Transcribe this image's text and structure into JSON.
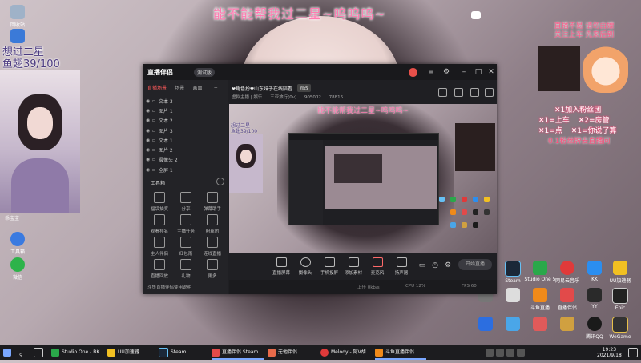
{
  "overlay_title": "能不能帮我过二星~呜呜呜~",
  "camera": {
    "text_line1": "想过二星",
    "text_line2": "鱼翅39/100",
    "name": "乖宝宝"
  },
  "right_panel": {
    "line1": "直播不易 请勿白嫖",
    "line2": "关注上车 先来后到",
    "rules": [
      "✕1加入粉丝团",
      "✕1=上车",
      "✕2=房管",
      "✕1=点",
      "✕1=你说了算",
      "0.1粉丝牌去直播间"
    ]
  },
  "desktop_left": [
    {
      "label": "回收站"
    },
    {
      "label": "Steam++"
    },
    {
      "label": "工具箱"
    },
    {
      "label": "微信"
    }
  ],
  "desktop_right": [
    {
      "label": "Steam"
    },
    {
      "label": "Studio One 5"
    },
    {
      "label": "网易云音乐"
    },
    {
      "label": "酷狗音乐"
    },
    {
      "label": "KK"
    },
    {
      "label": "UU加速器"
    },
    {
      "label": "斗鱼直播"
    },
    {
      "label": "直播伴侣"
    },
    {
      "label": "YY"
    },
    {
      "label": "Epic"
    },
    {
      "label": "VoiceMod"
    },
    {
      "label": "腾讯QQ"
    },
    {
      "label": "哔哩哔哩"
    },
    {
      "label": "WeGame"
    }
  ],
  "app": {
    "logo": "直播伴侣",
    "version": "测试版",
    "sidebar": {
      "tabs": [
        "直播场景",
        "场景",
        "画面"
      ],
      "active_tab": 0,
      "layers": [
        "文本 3",
        "图片 1",
        "文本 2",
        "图片 3",
        "文本 1",
        "图片 2",
        "摄像头 2",
        "全屏 1"
      ],
      "tools_title": "工具箱",
      "tools": [
        {
          "label": "福袋抽奖"
        },
        {
          "label": "分享"
        },
        {
          "label": "弹幕助手"
        },
        {
          "label": "观看排名"
        },
        {
          "label": "主播任务"
        },
        {
          "label": "粉丝团"
        },
        {
          "label": "主人伴侣"
        },
        {
          "label": "红包雨"
        },
        {
          "label": "连线直播"
        },
        {
          "label": "直播回放"
        },
        {
          "label": "礼物"
        },
        {
          "label": "更多"
        }
      ],
      "footer": "斗鱼直播伴侣使用说明"
    },
    "room": {
      "title": "❤角色扮❤山东妹子在线陪看",
      "badge": "修改",
      "category": "虚拟主播 | 娱乐",
      "followers": "三亚旅行(0v)",
      "viewers": "905002",
      "hot": "78816"
    },
    "preview": {
      "title": "能不能帮我过二星~呜呜呜~",
      "text_line1": "想过二星",
      "text_line2": "鱼翅39/100"
    },
    "controls": [
      {
        "label": "直播屏幕"
      },
      {
        "label": "摄像头"
      },
      {
        "label": "手机投屏"
      },
      {
        "label": "添加素材"
      },
      {
        "label": "麦克风"
      },
      {
        "label": "扬声器"
      }
    ],
    "start_button": "开始直播",
    "status": {
      "left": "上传 0kb/s",
      "mid": "CPU 12%",
      "right": "FPS 60"
    }
  },
  "taskbar": {
    "items": [
      {
        "label": "Studio One - BK..."
      },
      {
        "label": "UU加速器"
      },
      {
        "label": "Steam"
      },
      {
        "label": "直播伴侣 Steam ..."
      },
      {
        "label": "无他伴侣"
      },
      {
        "label": "Melody - 阿V胡..."
      },
      {
        "label": "斗鱼直播伴侣"
      }
    ],
    "time": "19:23",
    "date": "2021/9/18"
  },
  "colors": {
    "accent_pink": "#ff7ab0",
    "app_bg": "#1f1f23",
    "active_tab": "#ff5a5a"
  }
}
